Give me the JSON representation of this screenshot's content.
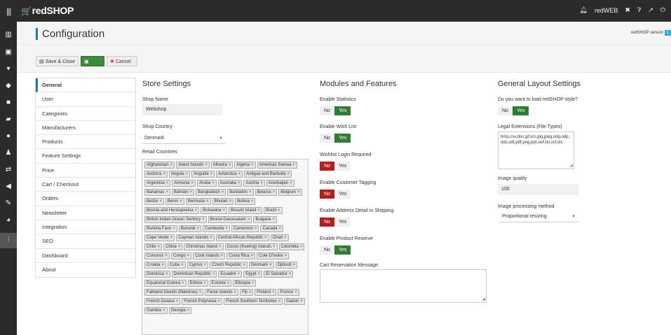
{
  "app": {
    "brand": "redSHOP",
    "user": "redWEB",
    "version_label": "redSHOP version",
    "version_badge": "1."
  },
  "page": {
    "title": "Configuration"
  },
  "toolbar": {
    "save_close": "Save & Close",
    "save": "Save",
    "cancel": "Cancel"
  },
  "tabs": [
    "General",
    "User",
    "Categories",
    "Manufacturers",
    "Products",
    "Feature Settings",
    "Price",
    "Cart / Checkout",
    "Orders",
    "Newsletter",
    "Integration",
    "SEO",
    "Dashboard",
    "About"
  ],
  "store": {
    "heading": "Store Settings",
    "shop_name_label": "Shop Name",
    "shop_name_value": "Webshop",
    "shop_country_label": "Shop Country",
    "shop_country_value": "Denmark",
    "retail_countries_label": "Retail Countries",
    "countries": [
      "Afghanistan",
      "Aland Islands",
      "Albania",
      "Algeria",
      "American Samoa",
      "Andorra",
      "Angola",
      "Anguilla",
      "Antarctica",
      "Antigua and Barbuda",
      "Argentina",
      "Armenia",
      "Aruba",
      "Australia",
      "Austria",
      "Azerbaijan",
      "Bahamas",
      "Bahrain",
      "Bangladesh",
      "Barbados",
      "Belarus",
      "Belgium",
      "Belize",
      "Benin",
      "Bermuda",
      "Bhutan",
      "Bolivia",
      "Bosnia and Herzegowina",
      "Botswana",
      "Bouvet Island",
      "Brazil",
      "British Indian Ocean Territory",
      "Brunei Darussalam",
      "Bulgaria",
      "Burkina Faso",
      "Burundi",
      "Cambodia",
      "Cameroon",
      "Canada",
      "Cape Verde",
      "Cayman Islands",
      "Central African Republic",
      "Chad",
      "Chile",
      "China",
      "Christmas Island",
      "Cocos (Keeling) Islands",
      "Colombia",
      "Comoros",
      "Congo",
      "Cook Islands",
      "Costa Rica",
      "Cote D'Ivoire",
      "Croatia",
      "Cuba",
      "Cyprus",
      "Czech Republic",
      "Denmark",
      "Djibouti",
      "Dominica",
      "Dominican Republic",
      "Ecuador",
      "Egypt",
      "El Salvador",
      "Equatorial Guinea",
      "Eritrea",
      "Estonia",
      "Ethiopia",
      "Falkland Islands (Malvinas)",
      "Faroe Islands",
      "Fiji",
      "Finland",
      "France",
      "French Guiana",
      "French Polynesia",
      "French Southern Territories",
      "Gabon",
      "Gambia",
      "Georgia"
    ]
  },
  "modules": {
    "heading": "Modules and Features",
    "items": [
      {
        "label": "Enable Statistics",
        "no": "No",
        "yes": "Yes",
        "value": "yes"
      },
      {
        "label": "Enable Wish List",
        "no": "No",
        "yes": "Yes",
        "value": "yes"
      },
      {
        "label": "Wishlist Login Required",
        "no": "No",
        "yes": "Yes",
        "value": "no"
      },
      {
        "label": "Enable Customer Tagging",
        "no": "No",
        "yes": "Yes",
        "value": "no"
      },
      {
        "label": "Enable Address Detail in Shipping",
        "no": "No",
        "yes": "Yes",
        "value": "no"
      },
      {
        "label": "Enable Product Reserve",
        "no": "No",
        "yes": "Yes",
        "value": "yes"
      }
    ],
    "cart_reservation_label": "Cart Reservation Message:"
  },
  "layout": {
    "heading": "General Layout Settings",
    "load_style_label": "Do you want to load redSHOP style?",
    "load_style_no": "No",
    "load_style_yes": "Yes",
    "legal_ext_label": "Legal Extensions (File Types)",
    "legal_ext_value": "bmp,csv,doc,gif,ico,jpg,jpeg,odg,odp,ods,odt,pdf,png,ppt,swf,txt,xcf,xls",
    "image_quality_label": "Image quality",
    "image_quality_value": "100",
    "image_method_label": "Image processing method",
    "image_method_value": "Proportional resizing"
  },
  "colors": {
    "topbar": "#2b2b2b",
    "accent": "#1e73be",
    "yes_on": "#2e7d32",
    "no_on": "#b71c1c",
    "save_btn": "#3b8a3e"
  }
}
